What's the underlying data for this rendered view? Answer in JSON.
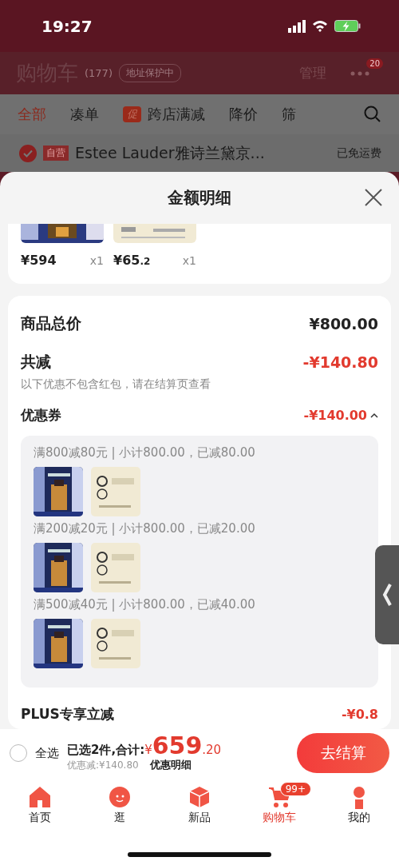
{
  "status_bar": {
    "time": "19:27"
  },
  "header": {
    "title": "购物车",
    "count": "(177)",
    "address_badge": "地址保护中",
    "manage": "管理",
    "more_badge": "20"
  },
  "filter_tabs": [
    {
      "label": "全部",
      "selected": true
    },
    {
      "label": "凑单",
      "selected": false
    },
    {
      "label": "跨店满减",
      "selected": false,
      "tag": "促"
    },
    {
      "label": "降价",
      "selected": false
    },
    {
      "label": "筛",
      "selected": false
    }
  ],
  "store": {
    "checked": true,
    "tag": "自营",
    "name": "Estee Lauder雅诗兰黛京...",
    "shipping": "已免运费"
  },
  "sheet": {
    "title": "金额明细",
    "products": [
      {
        "price": "¥594",
        "qty": "x1"
      },
      {
        "price": "¥65",
        "price_decimal": ".2",
        "qty": "x1"
      }
    ],
    "total_label": "商品总价",
    "total_value": "¥800.00",
    "reduce_label": "共减",
    "reduce_value": "-¥140.80",
    "reduce_note": "以下优惠不包含红包，请在结算页查看",
    "coupon_label": "优惠券",
    "coupon_value": "-¥140.00",
    "coupon_expanded": true,
    "coupon_groups": [
      {
        "text": "满800减80元 | 小计800.00，已减80.00"
      },
      {
        "text": "满200减20元 | 小计800.00，已减20.00"
      },
      {
        "text": "满500减40元 | 小计800.00，已减40.00"
      }
    ],
    "plus_label": "PLUS专享立减",
    "plus_value": "-¥0.8"
  },
  "checkout": {
    "select_all_checked": false,
    "select_all": "全选",
    "summary": "已选2件,合计:",
    "currency": "¥",
    "amount": "659",
    "amount_decimal": ".20",
    "discount": "优惠减:¥140.80",
    "detail_link": "优惠明细",
    "button": "去结算"
  },
  "tab_bar": [
    {
      "label": "首页",
      "selected": false,
      "kind": "home"
    },
    {
      "label": "逛",
      "selected": false,
      "kind": "face"
    },
    {
      "label": "新品",
      "selected": false,
      "kind": "box"
    },
    {
      "label": "购物车",
      "selected": true,
      "kind": "cart",
      "badge": "99+"
    },
    {
      "label": "我的",
      "selected": false,
      "kind": "person"
    }
  ]
}
